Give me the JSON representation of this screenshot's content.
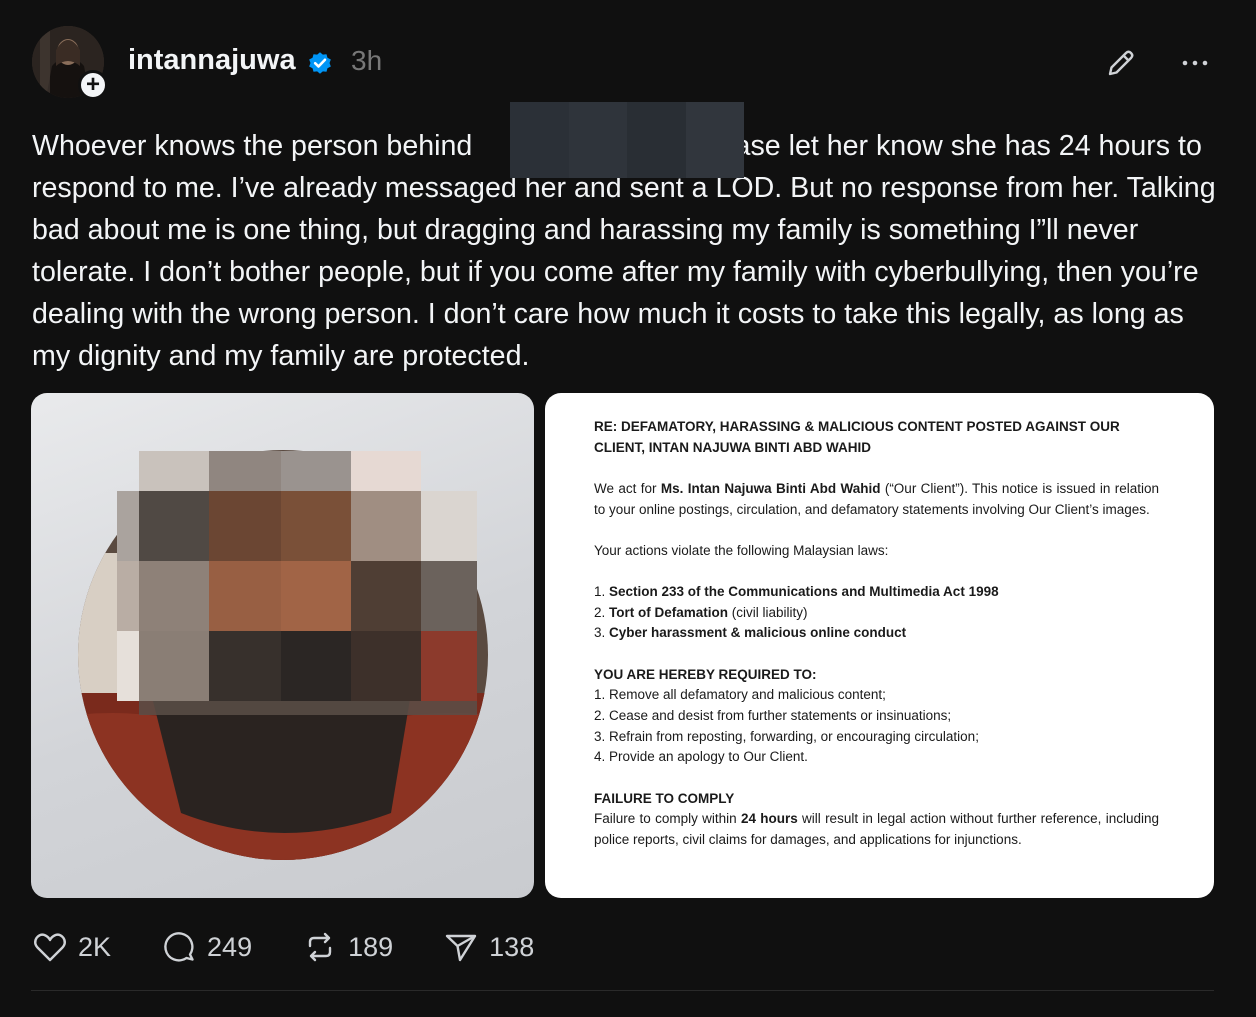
{
  "post": {
    "username": "intannajuwa",
    "time": "3h",
    "text_before_redaction": "Whoever knows the person behind",
    "text_after_redaction": "lease let her know she has 24 hours to respond to me. I’ve already messaged her and sent a LOD. But no response from her. Talking bad about me is one thing, but dragging and harassing my family is something I”ll never tolerate. I don’t bother people, but if you come after my family with cyberbullying, then you’re dealing with the wrong person. I don’t care how much it costs to take this legally, as long as my dignity and my family are protected."
  },
  "document": {
    "heading": "RE: DEFAMATORY, HARASSING & MALICIOUS CONTENT POSTED AGAINST OUR CLIENT, INTAN NAJUWA BINTI ABD WAHID",
    "intro_prefix": "We act for ",
    "intro_client": "Ms. Intan Najuwa Binti Abd Wahid",
    "intro_suffix": " (“Our Client”). This notice is issued in relation to your online postings, circulation, and defamatory statements involving Our Client’s images.",
    "laws_intro": "Your actions violate the following Malaysian laws:",
    "law1_bold": "Section 233 of the Communications and Multimedia Act 1998",
    "law2_bold": "Tort of Defamation",
    "law2_rest": " (civil liability)",
    "law3_bold": "Cyber harassment & malicious online conduct",
    "required_heading": "YOU ARE HEREBY REQUIRED TO:",
    "req1": "1. Remove all defamatory and malicious content;",
    "req2": "2. Cease and desist from further statements or insinuations;",
    "req3": "3. Refrain from reposting, forwarding, or encouraging circulation;",
    "req4": "4. Provide an apology to Our Client.",
    "failure_heading": "FAILURE TO COMPLY",
    "failure_prefix": "Failure to comply within ",
    "failure_bold": "24 hours",
    "failure_suffix": " will result in legal action without further reference, including police reports, civil claims for damages, and applications for injunctions."
  },
  "actions": {
    "likes": "2K",
    "replies": "249",
    "reposts": "189",
    "shares": "138"
  },
  "colors": {
    "background": "#101010",
    "text": "#f3f5f7",
    "muted": "#777777",
    "verified": "#0095f6"
  }
}
